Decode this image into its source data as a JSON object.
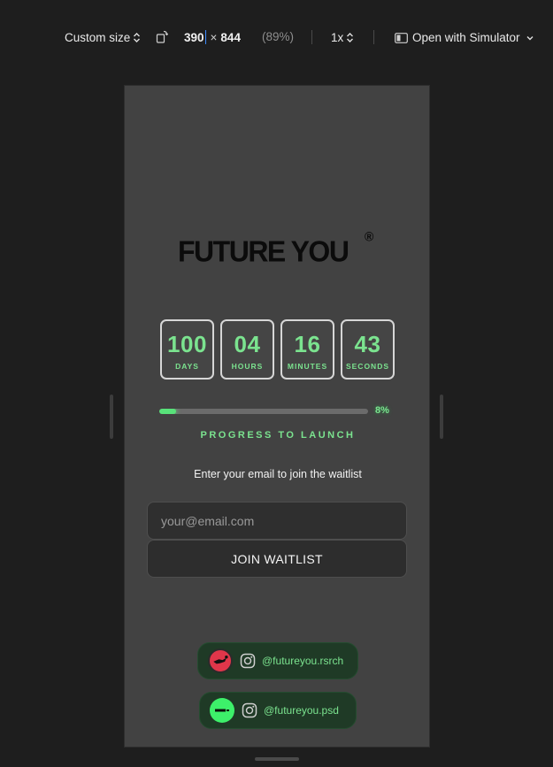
{
  "toolbar": {
    "size_mode": "Custom size",
    "width": "390",
    "times": "×",
    "height": "844",
    "zoom_percent": "(89%)",
    "scale": "1x",
    "open_with": "Open with Simulator"
  },
  "app": {
    "logo_text": "FUTURE YOU",
    "logo_mark": "®",
    "countdown": [
      {
        "value": "100",
        "unit": "DAYS"
      },
      {
        "value": "04",
        "unit": "HOURS"
      },
      {
        "value": "16",
        "unit": "MINUTES"
      },
      {
        "value": "43",
        "unit": "SECONDS"
      }
    ],
    "progress": {
      "fraction": 0.08,
      "percent_label": "8%",
      "label": "PROGRESS TO LAUNCH"
    },
    "waitlist_prompt": "Enter your email to join the waitlist",
    "email_placeholder": "your@email.com",
    "email_value": "",
    "join_label": "JOIN WAITLIST",
    "socials": [
      {
        "handle": "@futureyou.rsrch",
        "icon": "instagram-icon",
        "avatar_color": "#e0364a"
      },
      {
        "handle": "@futureyou.psd",
        "icon": "instagram-icon",
        "avatar_color": "#3df06a"
      }
    ]
  },
  "colors": {
    "accent_green": "#7be38f",
    "progress_green": "#58e27a",
    "screen_bg": "#424242",
    "app_bg": "#1e1e1e"
  }
}
